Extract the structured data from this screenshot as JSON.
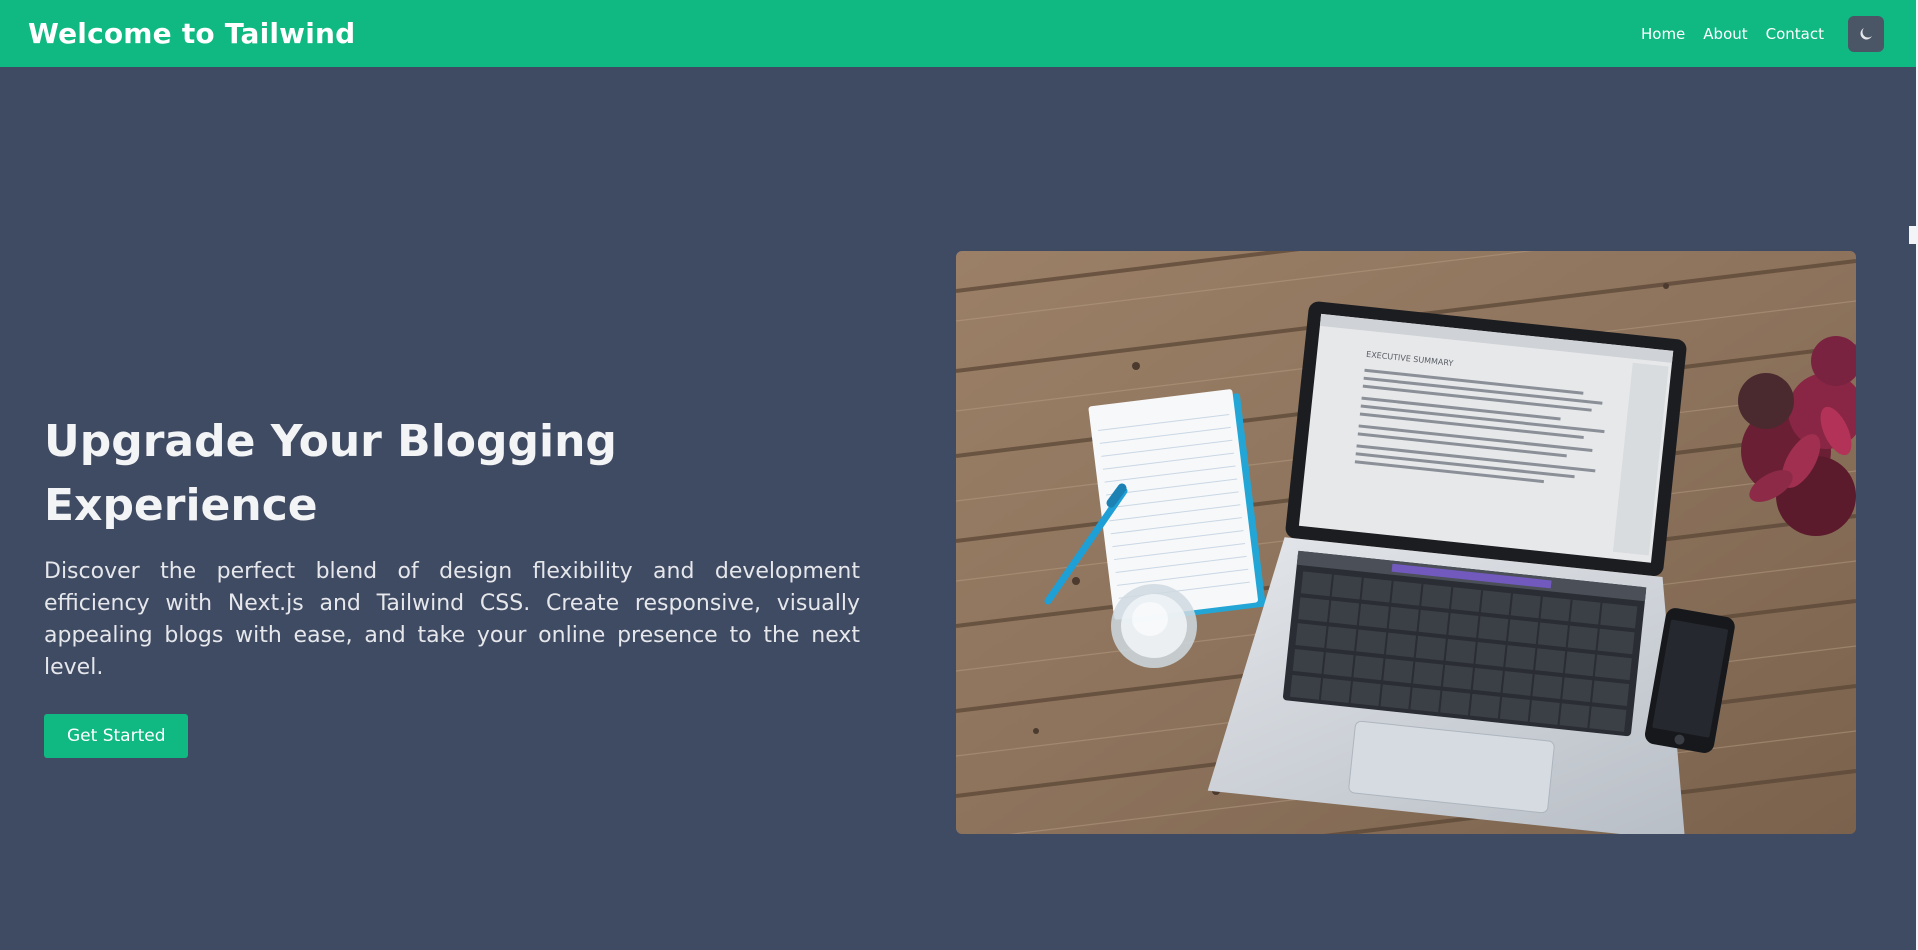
{
  "navbar": {
    "brand": "Welcome to Tailwind",
    "links": [
      "Home",
      "About",
      "Contact"
    ],
    "theme_toggle_icon": "moon-icon",
    "background": "#10b981"
  },
  "hero": {
    "title": "Upgrade Your Blogging Experience",
    "description": "Discover the perfect blend of design flexibility and development efficiency with Next.js and Tailwind CSS. Create responsive, visually appealing blogs with ease, and take your online presence to the next level.",
    "cta_label": "Get Started",
    "image_screen_heading": "EXECUTIVE SUMMARY"
  },
  "colors": {
    "page_background": "#3f4a63",
    "accent": "#10b981"
  }
}
